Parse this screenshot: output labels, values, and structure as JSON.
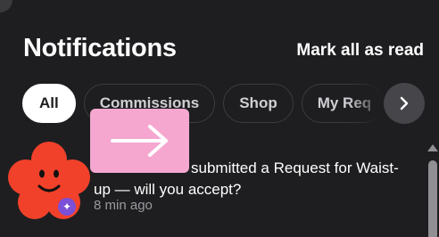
{
  "header": {
    "title": "Notifications",
    "mark_all_label": "Mark all as read"
  },
  "tabs": [
    {
      "label": "All",
      "active": true
    },
    {
      "label": "Commissions",
      "active": false
    },
    {
      "label": "Shop",
      "active": false
    },
    {
      "label": "My Req",
      "active": false
    }
  ],
  "tabs_next_icon": "chevron-right-icon",
  "notification": {
    "avatar_icon": "smiling-red-flower-avatar",
    "avatar_color": "#f2412a",
    "badge_icon": "sparkle-icon",
    "badge_color": "#7b4fd6",
    "requester_icon": "arrow-right-icon",
    "requester_color": "#f5a7cf",
    "message_line1": "submitted a Request for Waist-",
    "message_line2": "up — will you accept?",
    "time": "8 min ago"
  },
  "colors": {
    "background": "#1e1e20",
    "text": "#ffffff",
    "muted": "#9a9aa0",
    "tab_border": "#3c3c40"
  }
}
